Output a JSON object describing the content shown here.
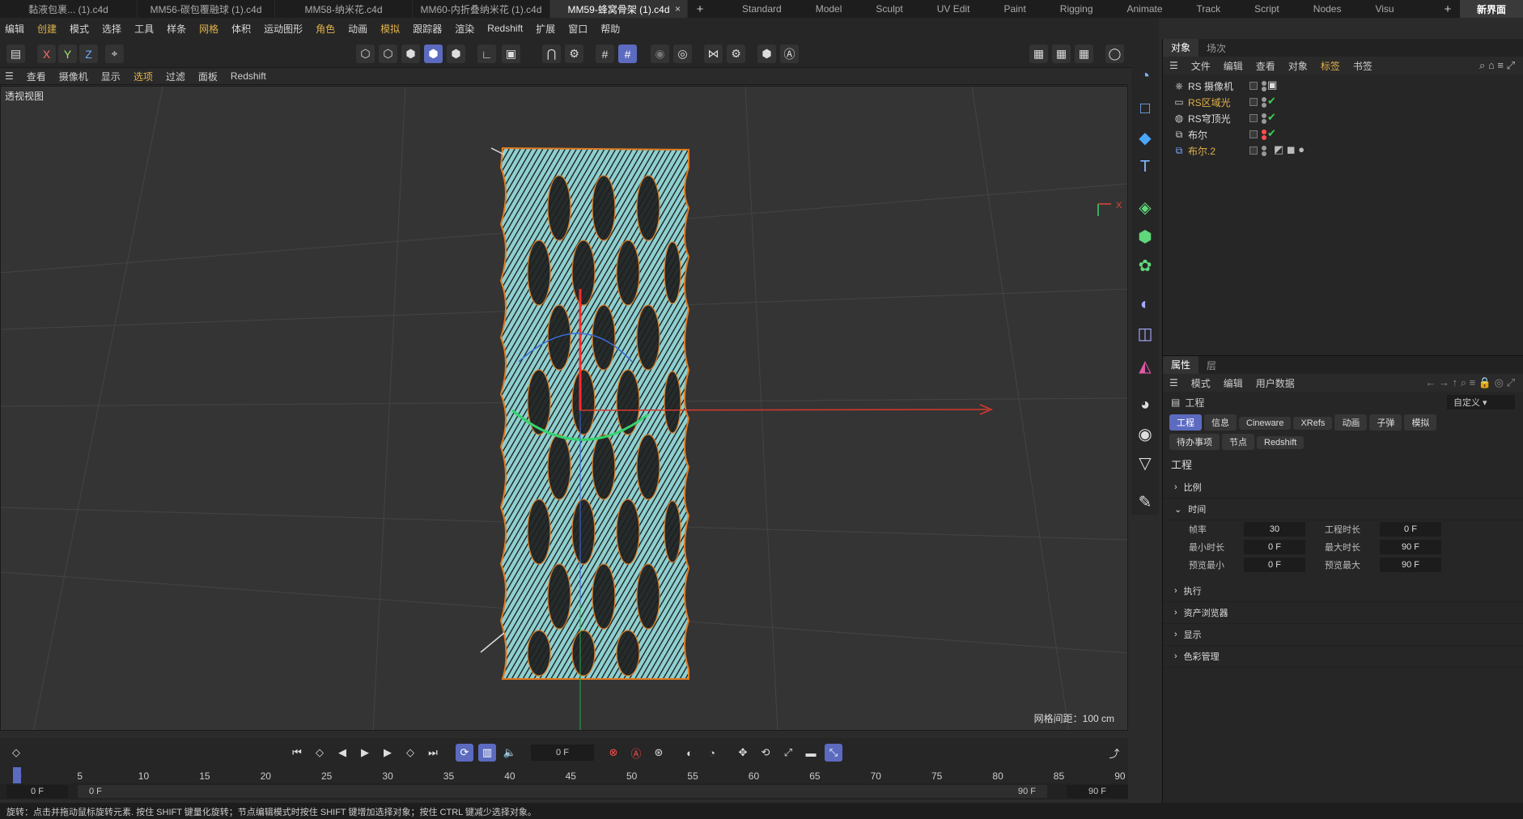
{
  "file_tabs": [
    {
      "label": "黏液包裹... (1).c4d",
      "active": false
    },
    {
      "label": "MM56-碳包覆融球 (1).c4d",
      "active": false
    },
    {
      "label": "MM58-纳米花.c4d",
      "active": false
    },
    {
      "label": "MM60-内折叠纳米花 (1).c4d",
      "active": false
    },
    {
      "label": "MM59-蜂窝骨架 (1).c4d",
      "active": true
    }
  ],
  "close_glyph": "×",
  "plus_glyph": "+",
  "layouts": [
    "Standard",
    "Model",
    "Sculpt",
    "UV Edit",
    "Paint",
    "Rigging",
    "Animate",
    "Track",
    "Script",
    "Nodes",
    "Visu"
  ],
  "new_layout": "新界面",
  "menu": [
    "编辑",
    "创建",
    "模式",
    "选择",
    "工具",
    "样条",
    "网格",
    "体积",
    "运动图形",
    "角色",
    "动画",
    "模拟",
    "跟踪器",
    "渲染",
    "Redshift",
    "扩展",
    "窗口",
    "帮助"
  ],
  "toolbar": {
    "x": "X",
    "y": "Y",
    "z": "Z"
  },
  "viewport_menu": [
    "查看",
    "摄像机",
    "显示",
    "选项",
    "过滤",
    "面板",
    "Redshift"
  ],
  "viewport": {
    "title": "透视视图",
    "grid_info": "网格间距：100 cm",
    "axis_x": "X"
  },
  "objects_panel": {
    "tabs": [
      "对象",
      "场次"
    ],
    "menu": [
      "文件",
      "编辑",
      "查看",
      "对象",
      "标签",
      "书签"
    ],
    "items": [
      {
        "name": "RS 摄像机",
        "color": "#dddddd",
        "icon": "camera-icon"
      },
      {
        "name": "RS区域光",
        "color": "#e0b14a",
        "icon": "area-light-icon"
      },
      {
        "name": "RS穹顶光",
        "color": "#dddddd",
        "icon": "dome-light-icon"
      },
      {
        "name": "布尔",
        "color": "#dddddd",
        "icon": "boolean-icon"
      },
      {
        "name": "布尔.2",
        "color": "#e0b14a",
        "icon": "boolean-icon"
      }
    ]
  },
  "attr_panel": {
    "tabs": [
      "属性",
      "层"
    ],
    "menu": [
      "模式",
      "编辑",
      "用户数据"
    ],
    "header": "工程",
    "preset": "自定义",
    "buttons_row1": [
      "工程",
      "信息",
      "Cineware",
      "XRefs",
      "动画",
      "子弹",
      "模拟"
    ],
    "buttons_row2": [
      "待办事项",
      "节点",
      "Redshift"
    ],
    "section_title": "工程",
    "sections": [
      "比例",
      "时间",
      "执行",
      "资产浏览器",
      "显示",
      "色彩管理"
    ],
    "fields": [
      {
        "l1": "帧率",
        "v1": "30",
        "l2": "工程时长",
        "v2": "0 F"
      },
      {
        "l1": "最小时长",
        "v1": "0 F",
        "l2": "最大时长",
        "v2": "90 F"
      },
      {
        "l1": "预览最小",
        "v1": "0 F",
        "l2": "预览最大",
        "v2": "90 F"
      }
    ]
  },
  "timeline": {
    "current_frame": "0 F",
    "ticks": [
      "0",
      "5",
      "10",
      "15",
      "20",
      "25",
      "30",
      "35",
      "40",
      "45",
      "50",
      "55",
      "60",
      "65",
      "70",
      "75",
      "80",
      "85",
      "90"
    ],
    "start": "0 F",
    "range_start": "0 F",
    "range_end": "90 F",
    "end": "90 F"
  },
  "status": "旋转：点击并拖动鼠标旋转元素. 按住 SHIFT 键量化旋转；节点编辑模式时按住 SHIFT 键增加选择对象；按住 CTRL 键减少选择对象。"
}
